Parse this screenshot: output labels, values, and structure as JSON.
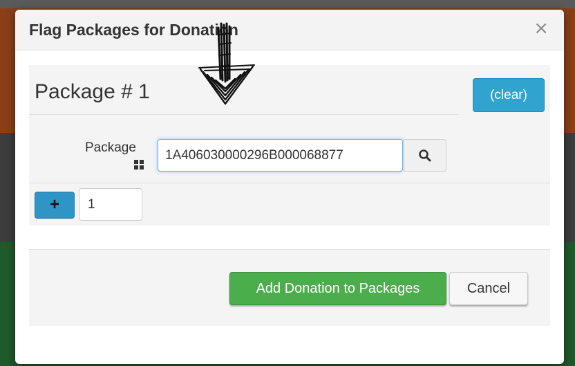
{
  "dialog": {
    "title": "Flag Packages for Donation",
    "close_glyph": "×"
  },
  "package_block": {
    "heading": "Package # 1",
    "clear_label": "(clear)",
    "package_label": "Package",
    "package_value": "1A406030000296B000068877",
    "quantity_value": "1",
    "add_row_glyph": "+"
  },
  "footer": {
    "add_button_label": "Add Donation to Packages",
    "cancel_button_label": "Cancel"
  },
  "colors": {
    "clear_button": "#31a3cf",
    "add_button": "#4cad4c",
    "input_focus": "#66afe9"
  },
  "icons": [
    "close-icon",
    "barcode-grid-icon",
    "search-icon",
    "plus-icon",
    "hand-drawn-arrow-icon"
  ]
}
